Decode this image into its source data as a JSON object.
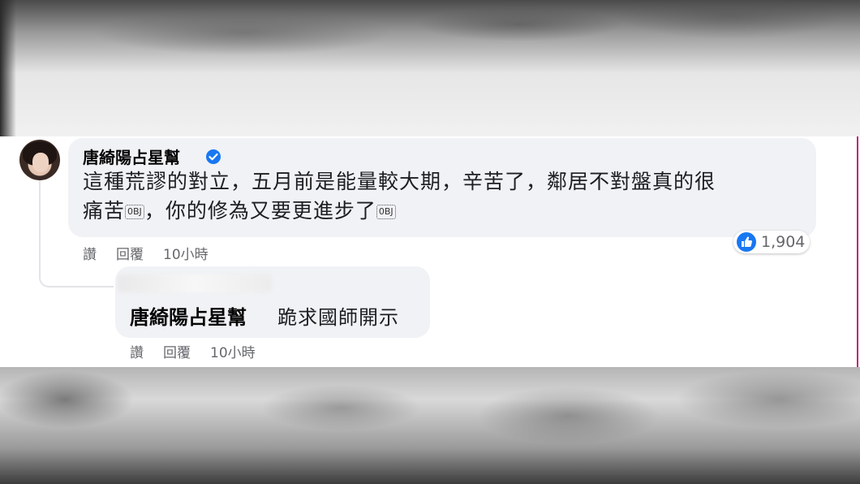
{
  "comment": {
    "author": "唐綺陽占星幫",
    "text_line1": "這種荒謬的對立，五月前是能量較大期，辛苦了，鄰居不對盤真的很",
    "text_line2_a": "痛苦",
    "emoji_1": "0BJ",
    "text_line2_b": "，你的修為又要更進步了",
    "emoji_2": "0BJ",
    "reaction_count": "1,904",
    "actions": {
      "like": "讚",
      "reply": "回覆",
      "time": "10小時"
    }
  },
  "reply": {
    "author": "唐綺陽占星幫",
    "text": "跪求國師開示",
    "actions": {
      "like": "讚",
      "reply": "回覆",
      "time": "10小時"
    }
  },
  "icons": {
    "verified": "verified-badge-icon",
    "reaction": "like-thumb-icon"
  },
  "colors": {
    "accent": "#1877f2",
    "bubble": "#f0f2f5",
    "meta": "#65676b"
  }
}
